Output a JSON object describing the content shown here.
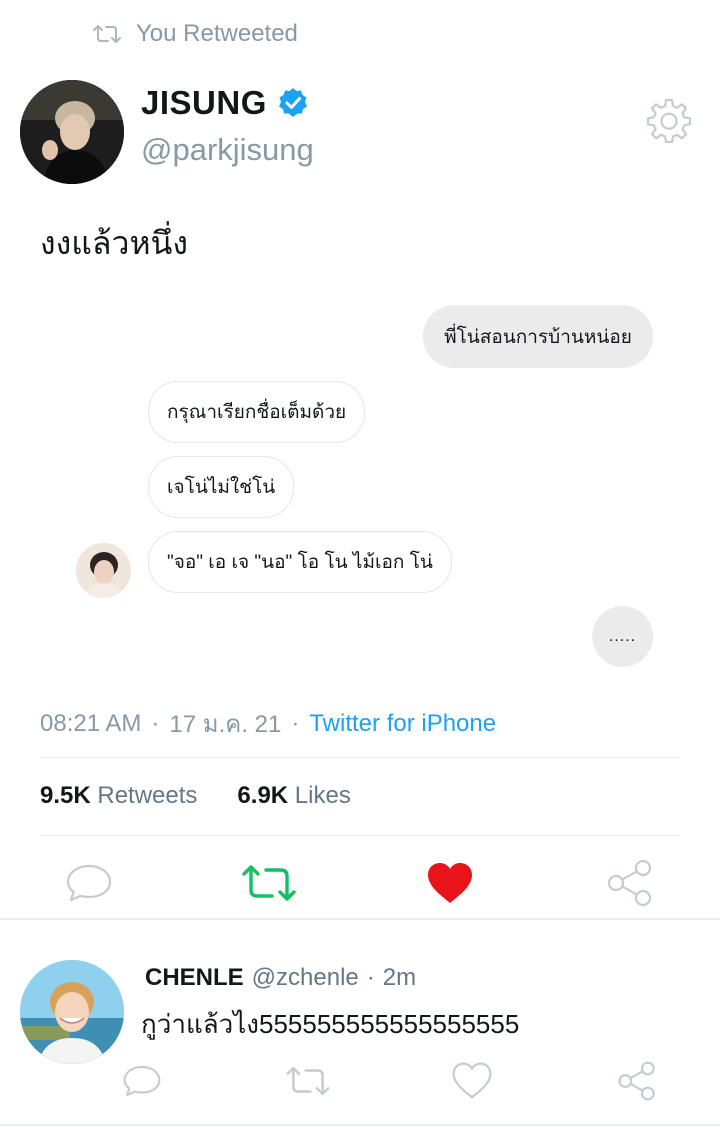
{
  "retweet_header": {
    "label": "You Retweeted"
  },
  "tweet": {
    "author_name": "JISUNG",
    "author_handle": "@parkjisung",
    "text": "งงแล้วหนึ่ง",
    "chat": {
      "right_message": "พี่โน่สอนการบ้านหน่อย",
      "left_messages": [
        "กรุณาเรียกชื่อเต็มด้วย",
        "เจโน่ไม่ใช่โน่",
        "\"จอ\" เอ เจ \"นอ\" โอ โน ไม้เอก โน่"
      ],
      "typing_dots": "....."
    },
    "time": "08:21 AM",
    "date": "17 ม.ค. 21",
    "source": "Twitter for iPhone",
    "retweets_count": "9.5K",
    "retweets_label": "Retweets",
    "likes_count": "6.9K",
    "likes_label": "Likes",
    "colors": {
      "accent": "#1da1f2",
      "retweet_active": "#17bf63",
      "like_active": "#e0245e"
    }
  },
  "reply": {
    "author_name": "CHENLE",
    "author_handle": "@zchenle",
    "separator": "·",
    "time": "2m",
    "text": "กูว่าแล้วไง555555555555555555"
  },
  "icons": {
    "retweet_header": "retweet-icon",
    "verified": "verified-badge-icon",
    "settings": "gear-icon",
    "reply": "comment-icon",
    "retweet": "retweet-icon",
    "like": "heart-icon",
    "share": "share-icon"
  }
}
